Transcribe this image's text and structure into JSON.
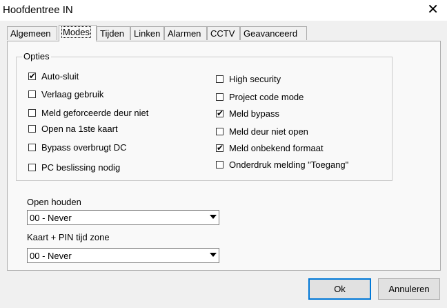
{
  "window": {
    "title": "Hoofdentree IN"
  },
  "tabs": [
    {
      "label": "Algemeen"
    },
    {
      "label": "Modes"
    },
    {
      "label": "Tijden"
    },
    {
      "label": "Linken"
    },
    {
      "label": "Alarmen"
    },
    {
      "label": "CCTV"
    },
    {
      "label": "Geavanceerd"
    }
  ],
  "active_tab": "Modes",
  "options": {
    "legend": "Opties",
    "left": [
      {
        "label": "Auto-sluit",
        "checked": true
      },
      {
        "label": "Verlaag gebruik",
        "checked": false
      },
      {
        "label": "Meld geforceerde deur niet",
        "checked": false
      },
      {
        "label": "Open na 1ste kaart",
        "checked": false
      },
      {
        "label": "Bypass overbrugt DC",
        "checked": false
      },
      {
        "label": "PC beslissing nodig",
        "checked": false
      }
    ],
    "right": [
      {
        "label": "High security",
        "checked": false
      },
      {
        "label": "Project code mode",
        "checked": false
      },
      {
        "label": "Meld bypass",
        "checked": true
      },
      {
        "label": "Meld deur niet open",
        "checked": false
      },
      {
        "label": "Meld onbekend formaat",
        "checked": true
      },
      {
        "label": "Onderdruk melding \"Toegang\"",
        "checked": false
      }
    ]
  },
  "open_houden": {
    "label": "Open houden",
    "value": "00 - Never"
  },
  "kaart_pin": {
    "label": "Kaart + PIN tijd zone",
    "value": "00 - Never"
  },
  "buttons": {
    "ok": "Ok",
    "cancel": "Annuleren"
  }
}
